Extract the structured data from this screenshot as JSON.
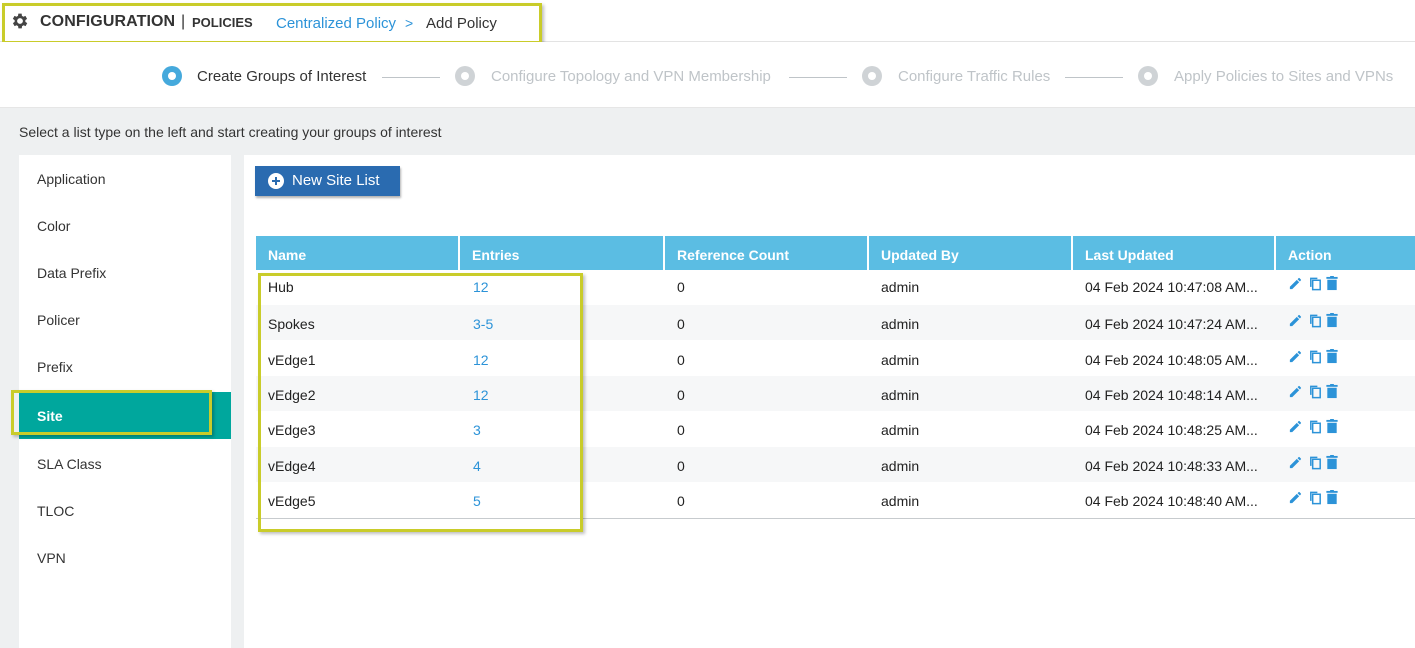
{
  "header": {
    "title": "CONFIGURATION",
    "separator": "|",
    "subtitle": "POLICIES",
    "breadcrumb_link": "Centralized Policy",
    "breadcrumb_arrow": ">",
    "breadcrumb_current": "Add Policy",
    "icon": "gear-icon"
  },
  "wizard": {
    "steps": [
      {
        "label": "Create Groups of Interest",
        "state": "active"
      },
      {
        "label": "Configure Topology and VPN Membership",
        "state": "inactive"
      },
      {
        "label": "Configure Traffic Rules",
        "state": "inactive"
      },
      {
        "label": "Apply Policies to Sites and VPNs",
        "state": "inactive"
      }
    ]
  },
  "instruction": "Select a list type on the left and start creating your groups of interest",
  "list_types": {
    "items": [
      "Application",
      "Color",
      "Data Prefix",
      "Policer",
      "Prefix",
      "Site",
      "SLA Class",
      "TLOC",
      "VPN"
    ],
    "selected": "Site"
  },
  "toolbar": {
    "new_button_label": "New Site List"
  },
  "table": {
    "columns": [
      "Name",
      "Entries",
      "Reference Count",
      "Updated By",
      "Last Updated",
      "Action"
    ],
    "rows": [
      {
        "name": "Hub",
        "entries": "12",
        "ref_count": "0",
        "updated_by": "admin",
        "last_updated": "04 Feb 2024 10:47:08 AM..."
      },
      {
        "name": "Spokes",
        "entries": "3-5",
        "ref_count": "0",
        "updated_by": "admin",
        "last_updated": "04 Feb 2024 10:47:24 AM..."
      },
      {
        "name": "vEdge1",
        "entries": "12",
        "ref_count": "0",
        "updated_by": "admin",
        "last_updated": "04 Feb 2024 10:48:05 AM..."
      },
      {
        "name": "vEdge2",
        "entries": "12",
        "ref_count": "0",
        "updated_by": "admin",
        "last_updated": "04 Feb 2024 10:48:14 AM..."
      },
      {
        "name": "vEdge3",
        "entries": "3",
        "ref_count": "0",
        "updated_by": "admin",
        "last_updated": "04 Feb 2024 10:48:25 AM..."
      },
      {
        "name": "vEdge4",
        "entries": "4",
        "ref_count": "0",
        "updated_by": "admin",
        "last_updated": "04 Feb 2024 10:48:33 AM..."
      },
      {
        "name": "vEdge5",
        "entries": "5",
        "ref_count": "0",
        "updated_by": "admin",
        "last_updated": "04 Feb 2024 10:48:40 AM..."
      }
    ],
    "action_icons": [
      "edit-icon",
      "copy-icon",
      "delete-icon"
    ]
  },
  "colors": {
    "accent": "#5bbde3",
    "selected": "#00a79d",
    "link": "#2c93d8",
    "button": "#2a6bb0",
    "highlight": "#c9cc2a"
  }
}
